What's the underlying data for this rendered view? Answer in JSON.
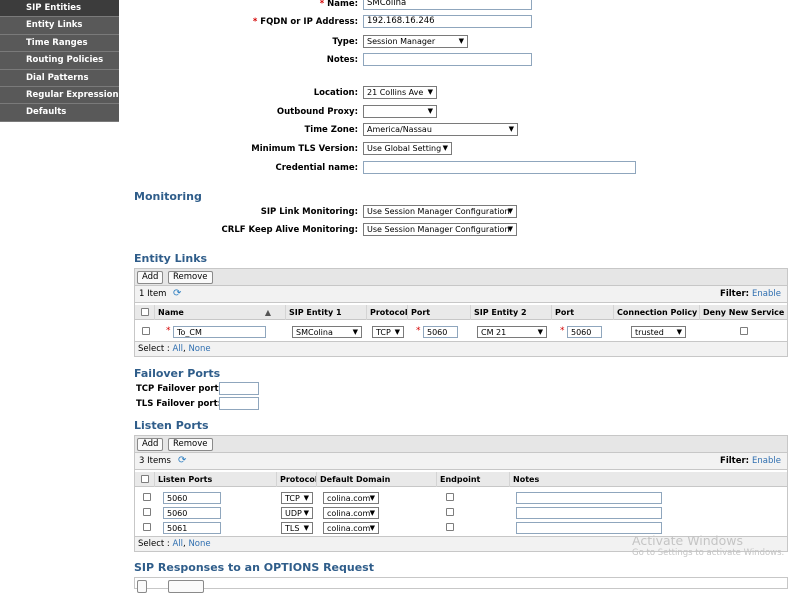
{
  "sidebar": {
    "items": [
      {
        "label": "SIP Entities"
      },
      {
        "label": "Entity Links"
      },
      {
        "label": "Time Ranges"
      },
      {
        "label": "Routing Policies"
      },
      {
        "label": "Dial Patterns"
      },
      {
        "label": "Regular Expressions"
      },
      {
        "label": "Defaults"
      }
    ]
  },
  "form": {
    "name_label": "Name:",
    "name_value": "SMColina",
    "fqdn_label": "FQDN or IP Address:",
    "fqdn_value": "192.168.16.246",
    "type_label": "Type:",
    "type_value": "Session Manager",
    "notes_label": "Notes:",
    "notes_value": "",
    "location_label": "Location:",
    "location_value": "21 Collins Ave",
    "outbound_label": "Outbound Proxy:",
    "outbound_value": "",
    "timezone_label": "Time Zone:",
    "timezone_value": "America/Nassau",
    "tls_label": "Minimum TLS Version:",
    "tls_value": "Use Global Setting",
    "credential_label": "Credential name:",
    "credential_value": "",
    "required_mark": "*"
  },
  "monitoring": {
    "title": "Monitoring",
    "sip_link_label": "SIP Link Monitoring:",
    "sip_link_value": "Use Session Manager Configuration",
    "crlf_label": "CRLF Keep Alive Monitoring:",
    "crlf_value": "Use Session Manager Configuration"
  },
  "entity_links": {
    "title": "Entity Links",
    "add_label": "Add",
    "remove_label": "Remove",
    "count": "1 Item",
    "filter_label": "Filter:",
    "filter_link": "Enable",
    "columns": [
      "Name",
      "SIP Entity 1",
      "Protocol",
      "Port",
      "SIP Entity 2",
      "Port",
      "Connection Policy",
      "Deny New Service"
    ],
    "rows": [
      {
        "name": "To_CM",
        "entity1": "SMColina",
        "protocol": "TCP",
        "port1": "5060",
        "entity2": "CM 21",
        "port2": "5060",
        "policy": "trusted"
      }
    ],
    "select_label": "Select :",
    "select_all": "All",
    "select_none": "None"
  },
  "failover": {
    "title": "Failover Ports",
    "tcp_label": "TCP Failover port:",
    "tls_label": "TLS Failover port:"
  },
  "listen_ports": {
    "title": "Listen Ports",
    "add_label": "Add",
    "remove_label": "Remove",
    "count": "3 Items",
    "filter_label": "Filter:",
    "filter_link": "Enable",
    "columns": [
      "Listen Ports",
      "Protocol",
      "Default Domain",
      "Endpoint",
      "Notes"
    ],
    "rows": [
      {
        "port": "5060",
        "protocol": "TCP",
        "domain": "colina.com"
      },
      {
        "port": "5060",
        "protocol": "UDP",
        "domain": "colina.com"
      },
      {
        "port": "5061",
        "protocol": "TLS",
        "domain": "colina.com"
      }
    ],
    "select_label": "Select :",
    "select_all": "All",
    "select_none": "None"
  },
  "sip_responses": {
    "title": "SIP Responses to an OPTIONS Request"
  },
  "watermark": {
    "line1": "Activate Windows",
    "line2": "Go to Settings to activate Windows."
  }
}
